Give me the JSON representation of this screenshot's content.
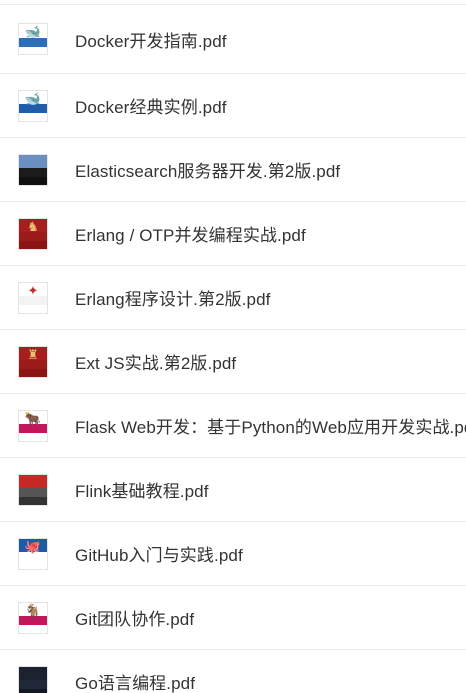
{
  "files": [
    {
      "name": "Docker开发指南.pdf",
      "icon": "whale-book-cover-icon",
      "cover": {
        "top": "#ffffff",
        "mid": "#2a6fb7",
        "bot": "#ffffff",
        "glyph": "🐋",
        "glyph_color": "#8a9aa8"
      }
    },
    {
      "name": "Docker经典实例.pdf",
      "icon": "whale-book-cover-icon",
      "cover": {
        "top": "#ffffff",
        "mid": "#1f5ea8",
        "bot": "#ffffff",
        "glyph": "🐋",
        "glyph_color": "#8a9aa8"
      }
    },
    {
      "name": "Elasticsearch服务器开发.第2版.pdf",
      "icon": "dark-book-cover-icon",
      "cover": {
        "top": "#6a8fc0",
        "mid": "#1b1b1b",
        "bot": "#111111",
        "glyph": "",
        "glyph_color": "#ffffff"
      }
    },
    {
      "name": "Erlang / OTP并发编程实战.pdf",
      "icon": "red-book-cover-icon",
      "cover": {
        "top": "#a81e1e",
        "mid": "#9b1a1a",
        "bot": "#8a1515",
        "glyph": "♞",
        "glyph_color": "#e8c070"
      }
    },
    {
      "name": "Erlang程序设计.第2版.pdf",
      "icon": "white-book-cover-icon",
      "cover": {
        "top": "#ffffff",
        "mid": "#f3f3f3",
        "bot": "#ffffff",
        "glyph": "✦",
        "glyph_color": "#c03030"
      }
    },
    {
      "name": "Ext JS实战.第2版.pdf",
      "icon": "red-book-cover-icon",
      "cover": {
        "top": "#a81e1e",
        "mid": "#9b1a1a",
        "bot": "#8a1515",
        "glyph": "♜",
        "glyph_color": "#e8c070"
      }
    },
    {
      "name": "Flask Web开发：基于Python的Web应用开发实战.pdf",
      "icon": "animal-book-cover-icon",
      "cover": {
        "top": "#ffffff",
        "mid": "#c2185b",
        "bot": "#ffffff",
        "glyph": "🐂",
        "glyph_color": "#555555"
      }
    },
    {
      "name": "Flink基础教程.pdf",
      "icon": "red-book-cover-icon",
      "cover": {
        "top": "#c62828",
        "mid": "#555555",
        "bot": "#333333",
        "glyph": "",
        "glyph_color": "#ffffff"
      }
    },
    {
      "name": "GitHub入门与实践.pdf",
      "icon": "octocat-book-cover-icon",
      "cover": {
        "top": "#1e5aa8",
        "mid": "#ffffff",
        "bot": "#ffffff",
        "glyph": "🐙",
        "glyph_color": "#222222"
      }
    },
    {
      "name": "Git团队协作.pdf",
      "icon": "animal-book-cover-icon",
      "cover": {
        "top": "#ffffff",
        "mid": "#c2185b",
        "bot": "#ffffff",
        "glyph": "🐐",
        "glyph_color": "#555555"
      }
    },
    {
      "name": "Go语言编程.pdf",
      "icon": "dark-book-cover-icon",
      "cover": {
        "top": "#1c2230",
        "mid": "#20283a",
        "bot": "#141820",
        "glyph": "",
        "glyph_color": "#ffffff"
      }
    }
  ]
}
